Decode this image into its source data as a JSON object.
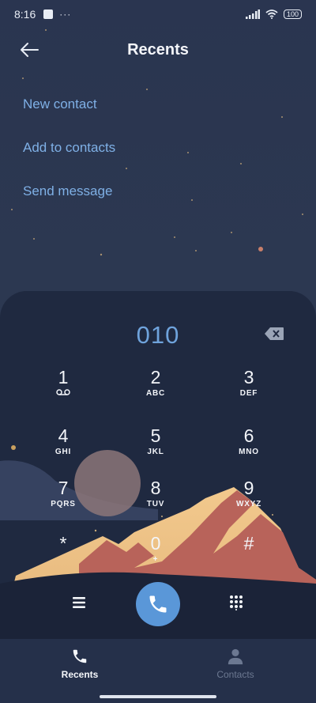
{
  "status_bar": {
    "time": "8:16",
    "overflow": "···",
    "battery": "100"
  },
  "header": {
    "title": "Recents"
  },
  "menu": {
    "new_contact": "New contact",
    "add_to_contacts": "Add to contacts",
    "send_message": "Send message"
  },
  "dialer": {
    "number": "010",
    "keys": [
      {
        "digit": "1",
        "letters": ""
      },
      {
        "digit": "2",
        "letters": "ABC"
      },
      {
        "digit": "3",
        "letters": "DEF"
      },
      {
        "digit": "4",
        "letters": "GHI"
      },
      {
        "digit": "5",
        "letters": "JKL"
      },
      {
        "digit": "6",
        "letters": "MNO"
      },
      {
        "digit": "7",
        "letters": "PQRS"
      },
      {
        "digit": "8",
        "letters": "TUV"
      },
      {
        "digit": "9",
        "letters": "WXYZ"
      },
      {
        "digit": "*",
        "letters": ""
      },
      {
        "digit": "0",
        "letters": "+"
      },
      {
        "digit": "#",
        "letters": ""
      }
    ]
  },
  "nav": {
    "recents": "Recents",
    "contacts": "Contacts"
  },
  "colors": {
    "accent": "#5a97d8",
    "link": "#7fb0e6",
    "number": "#6fa3dc",
    "panel": "#1f2940",
    "background": "#2a3550"
  },
  "icons": {
    "back": "arrow-left-icon",
    "backspace": "backspace-icon",
    "menu": "hamburger-icon",
    "call": "phone-icon",
    "dialpad": "dialpad-icon",
    "recents": "phone-icon",
    "contacts": "person-icon"
  }
}
